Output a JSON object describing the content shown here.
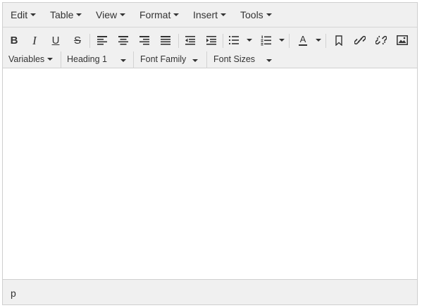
{
  "menubar": {
    "items": [
      {
        "label": "Edit"
      },
      {
        "label": "Table"
      },
      {
        "label": "View"
      },
      {
        "label": "Format"
      },
      {
        "label": "Insert"
      },
      {
        "label": "Tools"
      }
    ]
  },
  "toolbar": {
    "bold_label": "B",
    "italic_label": "I",
    "underline_label": "U",
    "strike_label": "S",
    "font_color_label": "A",
    "icons": [
      "bold-icon",
      "italic-icon",
      "underline-icon",
      "strikethrough-icon",
      "align-left-icon",
      "align-center-icon",
      "align-right-icon",
      "align-justify-icon",
      "outdent-icon",
      "indent-icon",
      "bullet-list-icon",
      "numbered-list-icon",
      "font-color-icon",
      "bookmark-icon",
      "link-icon",
      "unlink-icon",
      "image-icon"
    ],
    "variables_label": "Variables",
    "block_format_value": "Heading 1",
    "font_family_label": "Font Family",
    "font_sizes_label": "Font Sizes"
  },
  "statusbar": {
    "path": "p"
  },
  "colors": {
    "chrome_bg": "#f0f0f0",
    "border": "#cfcfcf",
    "text": "#333333"
  }
}
